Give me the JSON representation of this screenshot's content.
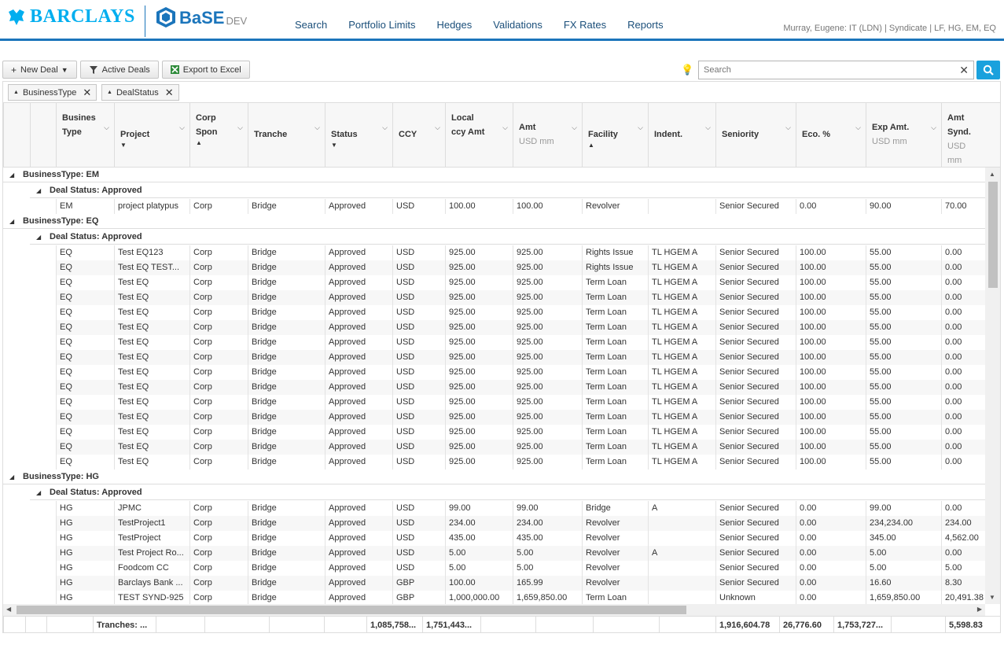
{
  "brand": {
    "bank": "BARCLAYS",
    "app": "BaSE",
    "env": "DEV",
    "color": "#00aeef"
  },
  "nav": [
    "Search",
    "Portfolio Limits",
    "Hedges",
    "Validations",
    "FX Rates",
    "Reports"
  ],
  "user_info": "Murray, Eugene: IT (LDN)  |  Syndicate  |  LF, HG, EM, EQ",
  "toolbar": {
    "new_deal": "New Deal",
    "active_deals": "Active Deals",
    "export": "Export to Excel"
  },
  "search": {
    "placeholder": "Search",
    "value": ""
  },
  "group_chips": [
    "BusinessType",
    "DealStatus"
  ],
  "columns": [
    {
      "label": "Busines\nType",
      "unit": ""
    },
    {
      "label": "Project",
      "unit": ""
    },
    {
      "label": "Corp\nSpon",
      "unit": ""
    },
    {
      "label": "Tranche",
      "unit": ""
    },
    {
      "label": "Status",
      "unit": ""
    },
    {
      "label": "CCY",
      "unit": ""
    },
    {
      "label": "Local\nccy Amt",
      "unit": ""
    },
    {
      "label": "Amt",
      "unit": "USD mm"
    },
    {
      "label": "Facility",
      "unit": ""
    },
    {
      "label": "Indent.",
      "unit": ""
    },
    {
      "label": "Seniority",
      "unit": ""
    },
    {
      "label": "Eco. %",
      "unit": ""
    },
    {
      "label": "Exp Amt.",
      "unit": "USD mm"
    },
    {
      "label": "Amt\nSynd.",
      "unit": "USD mm"
    }
  ],
  "groups": [
    {
      "label": "BusinessType: EM",
      "sub": "Deal Status: Approved",
      "rows": [
        [
          "EM",
          "project platypus",
          "Corp",
          "Bridge",
          "Approved",
          "USD",
          "100.00",
          "100.00",
          "Revolver",
          "",
          "Senior Secured",
          "0.00",
          "90.00",
          "70.00"
        ]
      ]
    },
    {
      "label": "BusinessType: EQ",
      "sub": "Deal Status: Approved",
      "rows": [
        [
          "EQ",
          "Test EQ123",
          "Corp",
          "Bridge",
          "Approved",
          "USD",
          "925.00",
          "925.00",
          "Rights Issue",
          "TL HGEM A",
          "Senior Secured",
          "100.00",
          "55.00",
          "0.00"
        ],
        [
          "EQ",
          "Test EQ TEST...",
          "Corp",
          "Bridge",
          "Approved",
          "USD",
          "925.00",
          "925.00",
          "Rights Issue",
          "TL HGEM A",
          "Senior Secured",
          "100.00",
          "55.00",
          "0.00"
        ],
        [
          "EQ",
          "Test EQ",
          "Corp",
          "Bridge",
          "Approved",
          "USD",
          "925.00",
          "925.00",
          "Term Loan",
          "TL HGEM A",
          "Senior Secured",
          "100.00",
          "55.00",
          "0.00"
        ],
        [
          "EQ",
          "Test EQ",
          "Corp",
          "Bridge",
          "Approved",
          "USD",
          "925.00",
          "925.00",
          "Term Loan",
          "TL HGEM A",
          "Senior Secured",
          "100.00",
          "55.00",
          "0.00"
        ],
        [
          "EQ",
          "Test EQ",
          "Corp",
          "Bridge",
          "Approved",
          "USD",
          "925.00",
          "925.00",
          "Term Loan",
          "TL HGEM A",
          "Senior Secured",
          "100.00",
          "55.00",
          "0.00"
        ],
        [
          "EQ",
          "Test EQ",
          "Corp",
          "Bridge",
          "Approved",
          "USD",
          "925.00",
          "925.00",
          "Term Loan",
          "TL HGEM A",
          "Senior Secured",
          "100.00",
          "55.00",
          "0.00"
        ],
        [
          "EQ",
          "Test EQ",
          "Corp",
          "Bridge",
          "Approved",
          "USD",
          "925.00",
          "925.00",
          "Term Loan",
          "TL HGEM A",
          "Senior Secured",
          "100.00",
          "55.00",
          "0.00"
        ],
        [
          "EQ",
          "Test EQ",
          "Corp",
          "Bridge",
          "Approved",
          "USD",
          "925.00",
          "925.00",
          "Term Loan",
          "TL HGEM A",
          "Senior Secured",
          "100.00",
          "55.00",
          "0.00"
        ],
        [
          "EQ",
          "Test EQ",
          "Corp",
          "Bridge",
          "Approved",
          "USD",
          "925.00",
          "925.00",
          "Term Loan",
          "TL HGEM A",
          "Senior Secured",
          "100.00",
          "55.00",
          "0.00"
        ],
        [
          "EQ",
          "Test EQ",
          "Corp",
          "Bridge",
          "Approved",
          "USD",
          "925.00",
          "925.00",
          "Term Loan",
          "TL HGEM A",
          "Senior Secured",
          "100.00",
          "55.00",
          "0.00"
        ],
        [
          "EQ",
          "Test EQ",
          "Corp",
          "Bridge",
          "Approved",
          "USD",
          "925.00",
          "925.00",
          "Term Loan",
          "TL HGEM A",
          "Senior Secured",
          "100.00",
          "55.00",
          "0.00"
        ],
        [
          "EQ",
          "Test EQ",
          "Corp",
          "Bridge",
          "Approved",
          "USD",
          "925.00",
          "925.00",
          "Term Loan",
          "TL HGEM A",
          "Senior Secured",
          "100.00",
          "55.00",
          "0.00"
        ],
        [
          "EQ",
          "Test EQ",
          "Corp",
          "Bridge",
          "Approved",
          "USD",
          "925.00",
          "925.00",
          "Term Loan",
          "TL HGEM A",
          "Senior Secured",
          "100.00",
          "55.00",
          "0.00"
        ],
        [
          "EQ",
          "Test EQ",
          "Corp",
          "Bridge",
          "Approved",
          "USD",
          "925.00",
          "925.00",
          "Term Loan",
          "TL HGEM A",
          "Senior Secured",
          "100.00",
          "55.00",
          "0.00"
        ],
        [
          "EQ",
          "Test EQ",
          "Corp",
          "Bridge",
          "Approved",
          "USD",
          "925.00",
          "925.00",
          "Term Loan",
          "TL HGEM A",
          "Senior Secured",
          "100.00",
          "55.00",
          "0.00"
        ]
      ]
    },
    {
      "label": "BusinessType: HG",
      "sub": "Deal Status: Approved",
      "rows": [
        [
          "HG",
          "JPMC",
          "Corp",
          "Bridge",
          "Approved",
          "USD",
          "99.00",
          "99.00",
          "Bridge",
          "A",
          "Senior Secured",
          "0.00",
          "99.00",
          "0.00"
        ],
        [
          "HG",
          "TestProject1",
          "Corp",
          "Bridge",
          "Approved",
          "USD",
          "234.00",
          "234.00",
          "Revolver",
          "",
          "Senior Secured",
          "0.00",
          "234,234.00",
          "234.00"
        ],
        [
          "HG",
          "TestProject",
          "Corp",
          "Bridge",
          "Approved",
          "USD",
          "435.00",
          "435.00",
          "Revolver",
          "",
          "Senior Secured",
          "0.00",
          "345.00",
          "4,562.00"
        ],
        [
          "HG",
          "Test Project Ro...",
          "Corp",
          "Bridge",
          "Approved",
          "USD",
          "5.00",
          "5.00",
          "Revolver",
          "A",
          "Senior Secured",
          "0.00",
          "5.00",
          "0.00"
        ],
        [
          "HG",
          "Foodcom CC",
          "Corp",
          "Bridge",
          "Approved",
          "USD",
          "5.00",
          "5.00",
          "Revolver",
          "",
          "Senior Secured",
          "0.00",
          "5.00",
          "5.00"
        ],
        [
          "HG",
          "Barclays Bank ...",
          "Corp",
          "Bridge",
          "Approved",
          "GBP",
          "100.00",
          "165.99",
          "Revolver",
          "",
          "Senior Secured",
          "0.00",
          "16.60",
          "8.30"
        ],
        [
          "HG",
          "TEST SYND-925",
          "Corp",
          "Bridge",
          "Approved",
          "GBP",
          "1,000,000.00",
          "1,659,850.00",
          "Term Loan",
          "",
          "Unknown",
          "0.00",
          "1,659,850.00",
          "20,491.38"
        ]
      ]
    }
  ],
  "totals": [
    "",
    "",
    "",
    "Tranches: ...",
    "",
    "",
    "",
    "",
    "1,085,758...",
    "1,751,443...",
    "",
    "",
    "",
    "",
    "1,916,604.78",
    "26,776.60",
    "1,753,727...",
    "",
    "5,598.83"
  ]
}
